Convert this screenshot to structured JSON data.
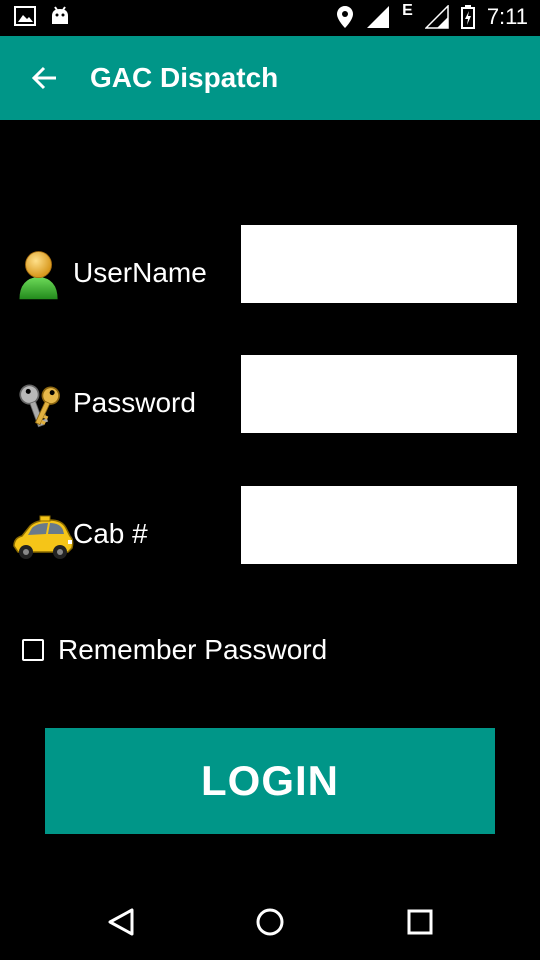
{
  "status_bar": {
    "time": "7:11",
    "network": "E",
    "icons": [
      "image-icon",
      "android-icon",
      "location-icon",
      "signal-icon",
      "signal-icon",
      "battery-charging-icon"
    ]
  },
  "app_bar": {
    "title": "GAC Dispatch",
    "back_icon": "arrow-back-icon",
    "color": "#009688"
  },
  "form": {
    "username": {
      "label": "UserName",
      "value": "",
      "icon": "user-icon"
    },
    "password": {
      "label": "Password",
      "value": "",
      "icon": "keys-icon"
    },
    "cab": {
      "label": "Cab #",
      "value": "",
      "icon": "taxi-icon"
    },
    "remember": {
      "label": "Remember Password",
      "checked": false
    }
  },
  "login_button": {
    "label": "LOGIN",
    "color": "#009688"
  },
  "nav_bar": {
    "icons": [
      "back-triangle-icon",
      "home-circle-icon",
      "recents-square-icon"
    ]
  }
}
